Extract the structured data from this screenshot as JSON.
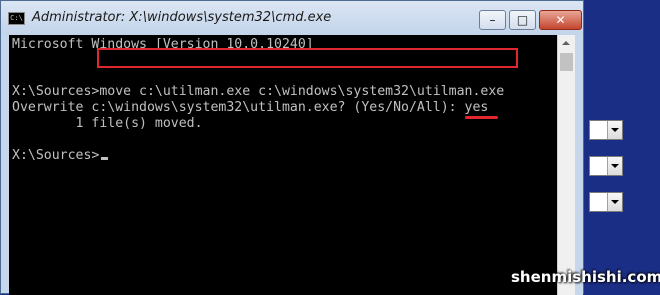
{
  "window": {
    "title": "Administrator: X:\\windows\\system32\\cmd.exe",
    "icon_text": "C:\\",
    "controls": {
      "minimize": "–",
      "maximize": "□",
      "close": "✕"
    }
  },
  "console": {
    "lines": [
      "Microsoft Windows [Version 10.0.10240]",
      "",
      "",
      "X:\\Sources>move c:\\utilman.exe c:\\windows\\system32\\utilman.exe",
      "Overwrite c:\\windows\\system32\\utilman.exe? (Yes/No/All): yes",
      "        1 file(s) moved.",
      "",
      "X:\\Sources>"
    ]
  },
  "watermark": "shenmishishi.com",
  "colors": {
    "highlight": "#e0262e",
    "console_text": "#c0c0c0",
    "console_bg": "#000000",
    "desktop_bg": "#1b2e86"
  }
}
